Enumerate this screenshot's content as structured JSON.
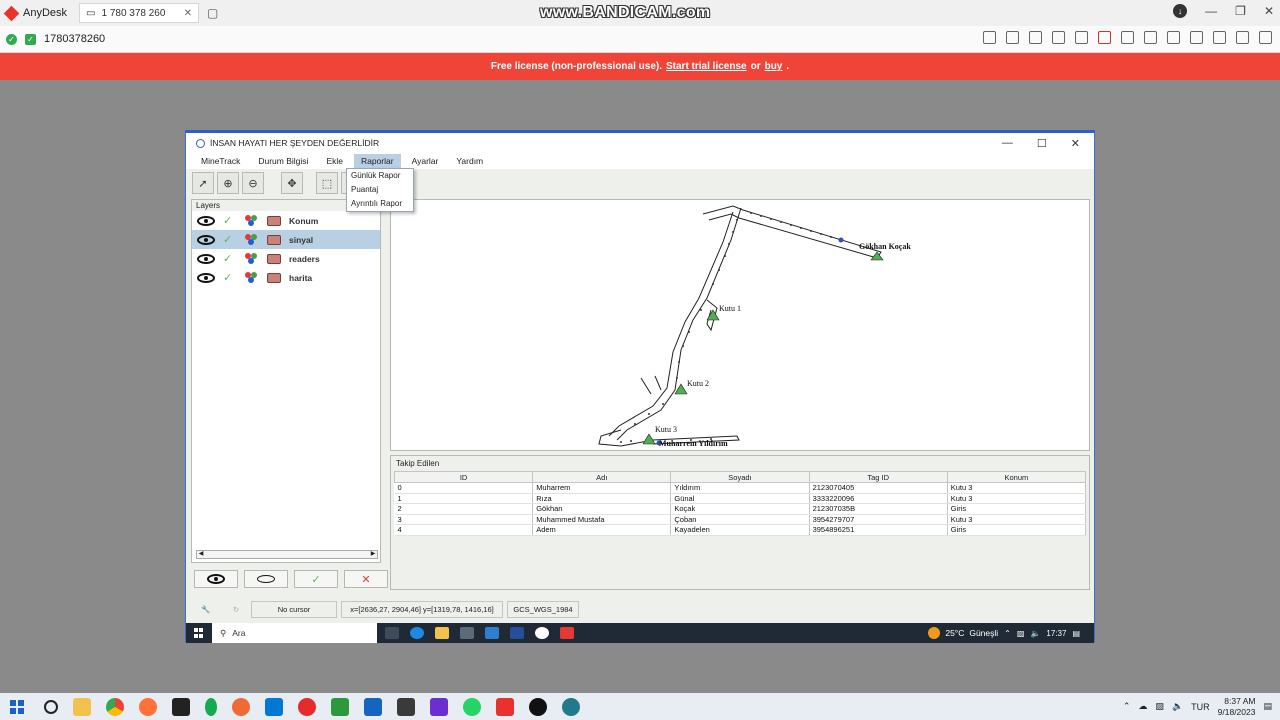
{
  "anydesk": {
    "app_name": "AnyDesk",
    "tab_address": "1 780 378 260",
    "connection_id": "1780378260",
    "watermark": "www.BANDICAM.com"
  },
  "license": {
    "text": "Free license (non-professional use).",
    "trial_link": "Start trial license",
    "or": "or",
    "buy_link": "buy",
    "end": "."
  },
  "window": {
    "title": "İNSAN HAYATI HER ŞEYDEN DEĞERLİDİR",
    "menus": [
      "MineTrack",
      "Durum Bilgisi",
      "Ekle",
      "Raporlar",
      "Ayarlar",
      "Yardım"
    ],
    "active_menu": "Raporlar",
    "dropdown": [
      "Günlük Rapor",
      "Puantaj",
      "Ayrıntılı Rapor"
    ]
  },
  "layers": {
    "title": "Layers",
    "items": [
      {
        "name": "Konum",
        "selected": false
      },
      {
        "name": "sinyal",
        "selected": true
      },
      {
        "name": "readers",
        "selected": false
      },
      {
        "name": "harita",
        "selected": false
      }
    ]
  },
  "map": {
    "labels": {
      "gokhan": "Gökhan Koçak",
      "kutu1": "Kutu 1",
      "kutu2": "Kutu 2",
      "kutu3": "Kutu 3",
      "muharrem": "Muharrem Yıldırım"
    }
  },
  "tracked": {
    "title": "Takip Edilen",
    "columns": [
      "ID",
      "Adı",
      "Soyadı",
      "Tag ID",
      "Konum"
    ],
    "rows": [
      [
        "0",
        "Muharrem",
        "Yıldırım",
        "2123070405",
        "Kutu 3"
      ],
      [
        "1",
        "Rıza",
        "Günal",
        "3333220096",
        "Kutu 3"
      ],
      [
        "2",
        "Gökhan",
        "Koçak",
        "212307035B",
        "Giris"
      ],
      [
        "3",
        "Muhammed Mustafa",
        "Çoban",
        "3954279707",
        "Kutu 3"
      ],
      [
        "4",
        "Adem",
        "Kayadelen",
        "3954896251",
        "Giris"
      ]
    ]
  },
  "status": {
    "cursor": "No cursor",
    "extent": "x=[2636,27, 2904,46] y=[1319,78, 1416,16]",
    "crs": "GCS_WGS_1984"
  },
  "inner_taskbar": {
    "search": "Ara",
    "weather": "25°C",
    "weather_text": "Güneşli",
    "time": "17:37"
  },
  "taskbar": {
    "lang": "TUR",
    "time": "8:37 AM",
    "date": "9/18/2023"
  },
  "colors": {
    "license_bar": "#f04438",
    "accent": "#2b5fc8",
    "selection": "#b8cfe4"
  }
}
